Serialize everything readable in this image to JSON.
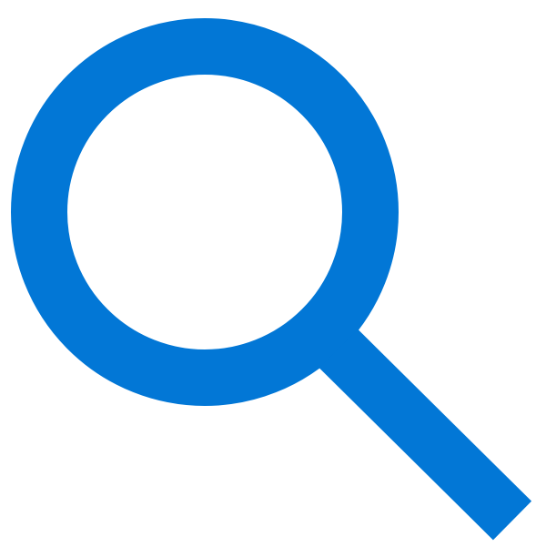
{
  "icon": {
    "name": "search-icon",
    "color": "#0277D6",
    "background": "#FFFFFF"
  }
}
